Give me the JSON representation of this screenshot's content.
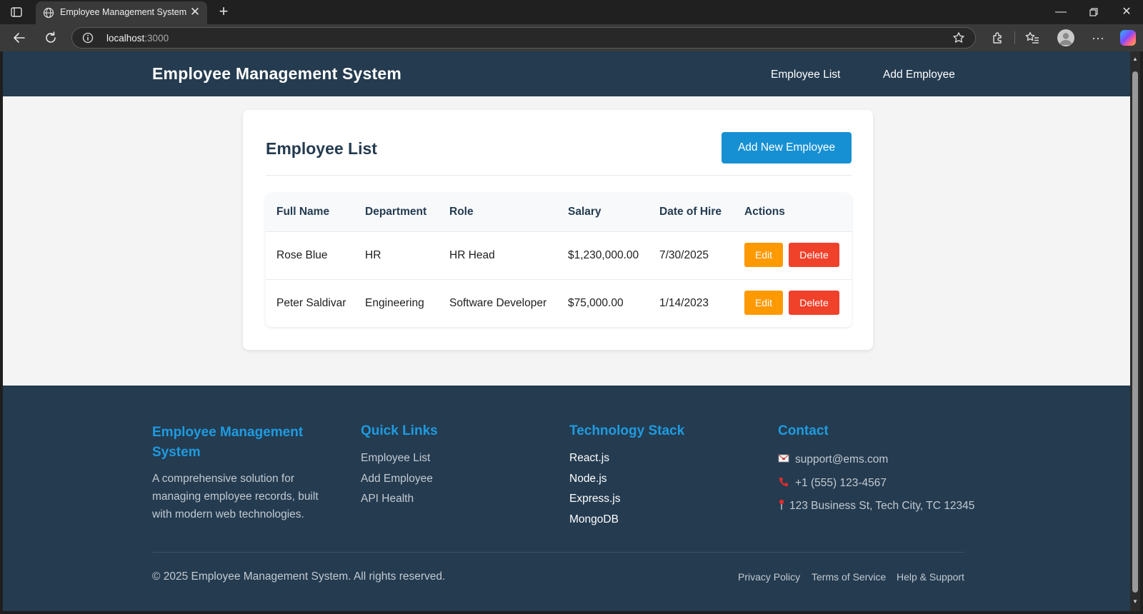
{
  "browser": {
    "tab_title": "Employee Management System",
    "url_host": "localhost",
    "url_port": ":3000"
  },
  "header": {
    "brand": "Employee Management System",
    "nav": [
      "Employee List",
      "Add Employee"
    ]
  },
  "card": {
    "title": "Employee List",
    "add_button": "Add New Employee",
    "columns": [
      "Full Name",
      "Department",
      "Role",
      "Salary",
      "Date of Hire",
      "Actions"
    ],
    "rows": [
      {
        "name": "Rose Blue",
        "department": "HR",
        "role": "HR Head",
        "salary": "$1,230,000.00",
        "hire_date": "7/30/2025"
      },
      {
        "name": "Peter Saldivar",
        "department": "Engineering",
        "role": "Software Developer",
        "salary": "$75,000.00",
        "hire_date": "1/14/2023"
      }
    ],
    "edit_label": "Edit",
    "delete_label": "Delete"
  },
  "footer": {
    "about_title": "Employee Management System",
    "about_text": "A comprehensive solution for managing employee records, built with modern web technologies.",
    "quick_links_title": "Quick Links",
    "quick_links": [
      "Employee List",
      "Add Employee",
      "API Health"
    ],
    "tech_title": "Technology Stack",
    "tech": [
      "React.js",
      "Node.js",
      "Express.js",
      "MongoDB"
    ],
    "contact_title": "Contact",
    "email": "support@ems.com",
    "phone": "+1 (555) 123-4567",
    "address": "123 Business St, Tech City, TC 12345",
    "copyright": "© 2025 Employee Management System. All rights reserved.",
    "bottom_links": [
      "Privacy Policy",
      "Terms of Service",
      "Help & Support"
    ]
  },
  "colors": {
    "navy": "#243b50",
    "accent_blue": "#1690d3",
    "edit_orange": "#ff9900",
    "delete_red": "#f0412b"
  }
}
